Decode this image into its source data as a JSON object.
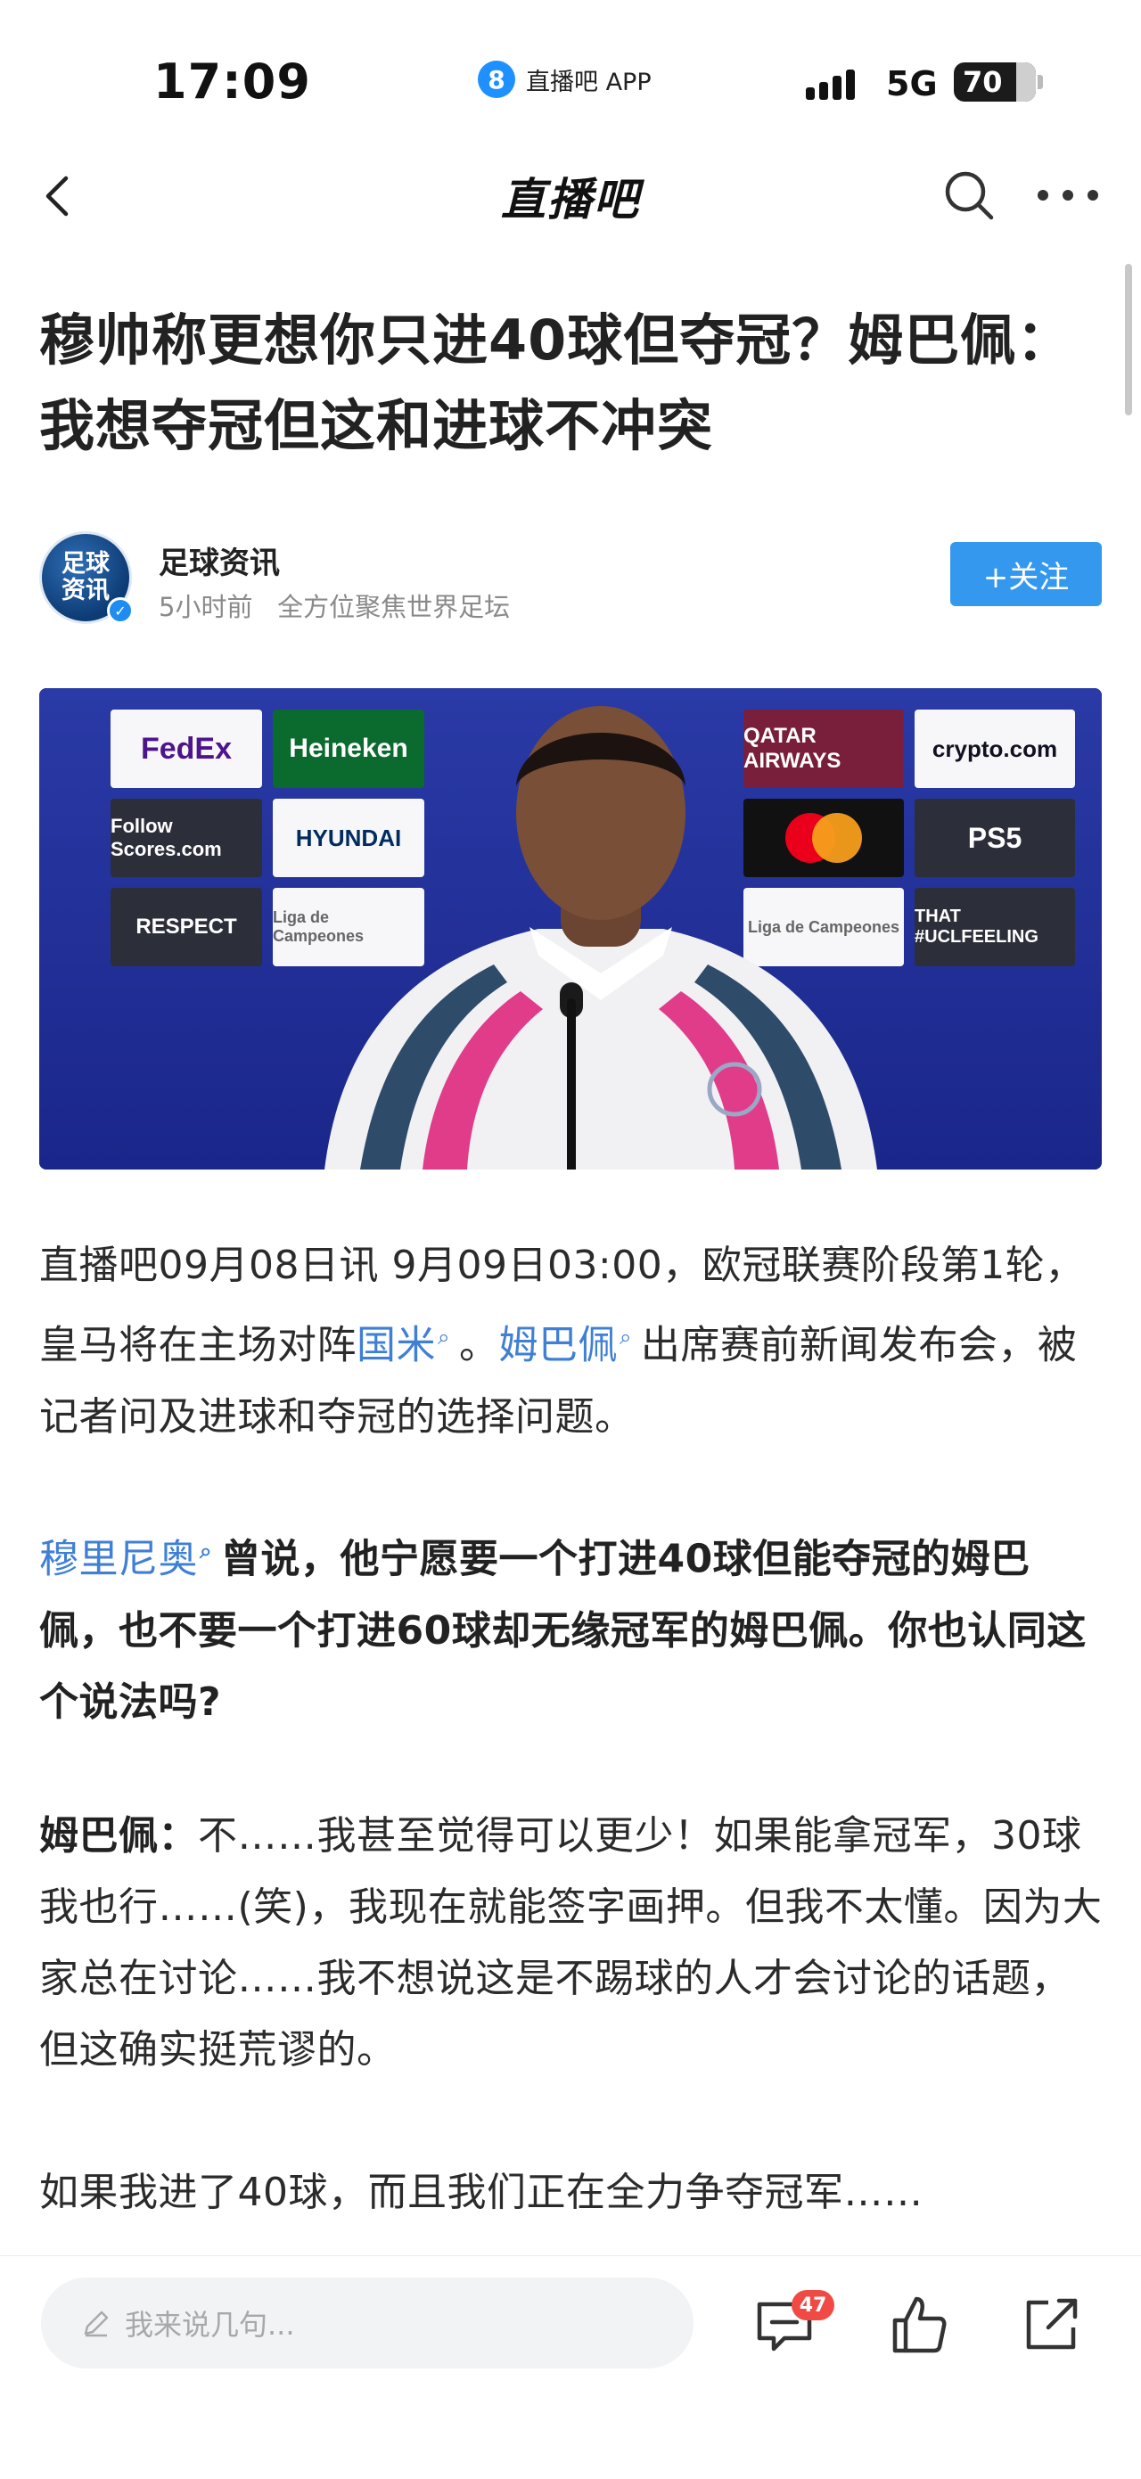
{
  "status_bar": {
    "time": "17:09",
    "app_badge": "8",
    "app_name": "直播吧 APP",
    "network": "5G",
    "battery": "70"
  },
  "nav": {
    "title": "直播吧",
    "icons": [
      "back-icon",
      "search-icon",
      "more-icon"
    ]
  },
  "article": {
    "headline": "穆帅称更想你只进40球但夺冠？姆巴佩：我想夺冠但这和进球不冲突",
    "author": {
      "avatar_text_1": "足球",
      "avatar_text_2": "资讯",
      "name": "足球资讯",
      "meta": "5小时前   全方位聚焦世界足坛",
      "follow_label": "+关注"
    },
    "photo": {
      "sponsors": [
        "FedEx",
        "Heineken",
        "QATAR AIRWAYS",
        "crypto.com",
        "Follow Scores.com",
        "HYUNDAI",
        "PS5",
        "RESPECT",
        "Liga de Campeones",
        "THAT #UCLFEELING"
      ]
    },
    "para1": {
      "text_a": "直播吧09月08日讯  9月09日03:00，欧冠联赛阶段第1轮，皇马将在主场对阵",
      "link_a": "国米",
      "text_b": "。",
      "link_b": "姆巴佩",
      "text_c": "出席赛前新闻发布会，被记者问及进球和夺冠的选择问题。"
    },
    "para2": {
      "link": "穆里尼奥",
      "text": "曾说，他宁愿要一个打进40球但能夺冠的姆巴佩，也不要一个打进60球却无缘冠军的姆巴佩。你也认同这个说法吗?"
    },
    "para3": {
      "speaker": "姆巴佩：",
      "text": "不……我甚至觉得可以更少！如果能拿冠军，30球我也行……(笑)，我现在就能签字画押。但我不太懂。因为大家总在讨论……我不想说这是不踢球的人才会讨论的话题，但这确实挺荒谬的。"
    },
    "para4": {
      "text": "如果我进了40球，而且我们正在全力争夺冠军……"
    }
  },
  "bottom_bar": {
    "comment_placeholder": "我来说几句...",
    "comment_count": "47"
  },
  "colors": {
    "accent": "#3498ef",
    "link": "#3f7fd6",
    "badge": "#f14a44"
  }
}
